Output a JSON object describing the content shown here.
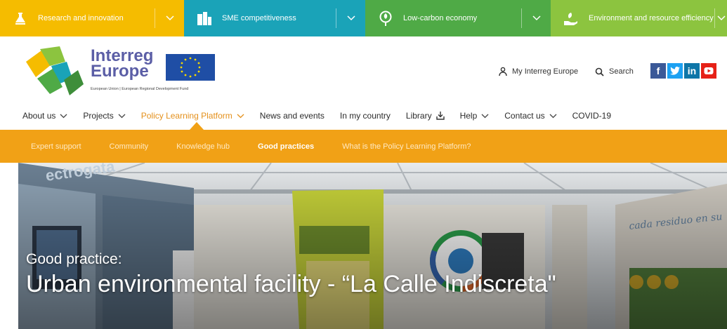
{
  "colors": {
    "theme_research": "#f5bc00",
    "theme_sme": "#1aa3b8",
    "theme_lowcarbon": "#4faa46",
    "theme_environment": "#8cc43f",
    "accent_orange": "#f1a116",
    "nav_active": "#e4901b",
    "logo_purple": "#5b5ea6",
    "facebook": "#3b5998",
    "twitter": "#1da1f2",
    "linkedin": "#0e76a8",
    "youtube": "#e62117"
  },
  "themes": [
    {
      "label": "Research and innovation",
      "icon": "flask-icon"
    },
    {
      "label": "SME competitiveness",
      "icon": "buildings-icon"
    },
    {
      "label": "Low-carbon economy",
      "icon": "leaf-icon"
    },
    {
      "label": "Environment and resource efficiency",
      "icon": "hand-leaf-icon"
    }
  ],
  "header": {
    "logo_word1": "Interreg",
    "logo_word2": "Europe",
    "logo_fund": "European Union | European Regional Development Fund",
    "account_label": "My Interreg Europe",
    "search_label": "Search",
    "social": [
      "f",
      "t",
      "in",
      "yt"
    ]
  },
  "mainnav": [
    {
      "label": "About us",
      "dropdown": true
    },
    {
      "label": "Projects",
      "dropdown": true
    },
    {
      "label": "Policy Learning Platform",
      "dropdown": true,
      "active": true
    },
    {
      "label": "News and events",
      "dropdown": false
    },
    {
      "label": "In my country",
      "dropdown": false
    },
    {
      "label": "Library",
      "dropdown": false,
      "icon": "download-icon"
    },
    {
      "label": "Help",
      "dropdown": true
    },
    {
      "label": "Contact us",
      "dropdown": true
    },
    {
      "label": "COVID-19",
      "dropdown": false
    }
  ],
  "subnav": [
    {
      "label": "Expert support"
    },
    {
      "label": "Community"
    },
    {
      "label": "Knowledge hub"
    },
    {
      "label": "Good practices",
      "active": true
    },
    {
      "label": "What is the Policy Learning Platform?"
    }
  ],
  "hero": {
    "kicker": "Good practice:",
    "title": "Urban environmental facility - “La Calle Indiscreta\""
  }
}
